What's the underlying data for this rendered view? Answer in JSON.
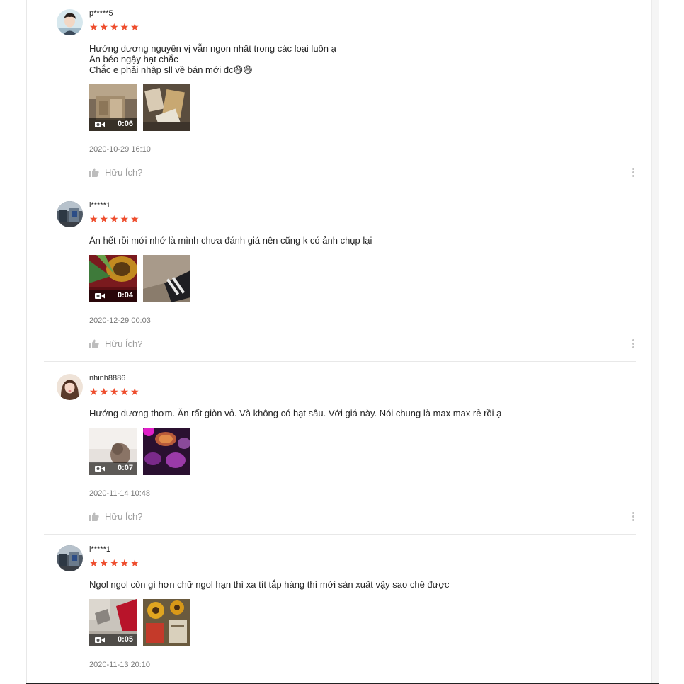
{
  "theme": {
    "star_color": "#ee4d2d"
  },
  "reviews": [
    {
      "username": "p*****5",
      "rating": 5,
      "comment": "Hướng dương nguyên vị vẫn ngon nhất trong các loại luôn ạ\nĂn béo ngậy hạt chắc\nChắc e phải nhập sll về bán mới đc😅😅",
      "video_duration": "0:06",
      "date": "2020-10-29 16:10",
      "helpful_label": "Hữu Ích?"
    },
    {
      "username": "l*****1",
      "rating": 5,
      "comment": "Ăn hết rồi mới nhớ là mình chưa đánh giá nên cũng k có ảnh chụp lại",
      "video_duration": "0:04",
      "date": "2020-12-29 00:03",
      "helpful_label": "Hữu Ích?"
    },
    {
      "username": "nhinh8886",
      "rating": 5,
      "comment": "Hướng dương thơm. Ăn rất giòn vỏ. Và không có hạt sâu. Với giá này. Nói chung là max max rẻ rồi ạ",
      "video_duration": "0:07",
      "date": "2020-11-14 10:48",
      "helpful_label": "Hữu Ích?"
    },
    {
      "username": "l*****1",
      "rating": 5,
      "comment": "Ngol ngol còn gì hơn chữ ngol hạn thì xa tít tắp hàng thì mới sản xuất vậy sao chê được",
      "video_duration": "0:05",
      "date": "2020-11-13 20:10"
    }
  ],
  "icons": {
    "star": "star-icon",
    "video": "video-camera-icon",
    "thumb": "thumbs-up-icon",
    "more": "more-vertical-icon"
  }
}
